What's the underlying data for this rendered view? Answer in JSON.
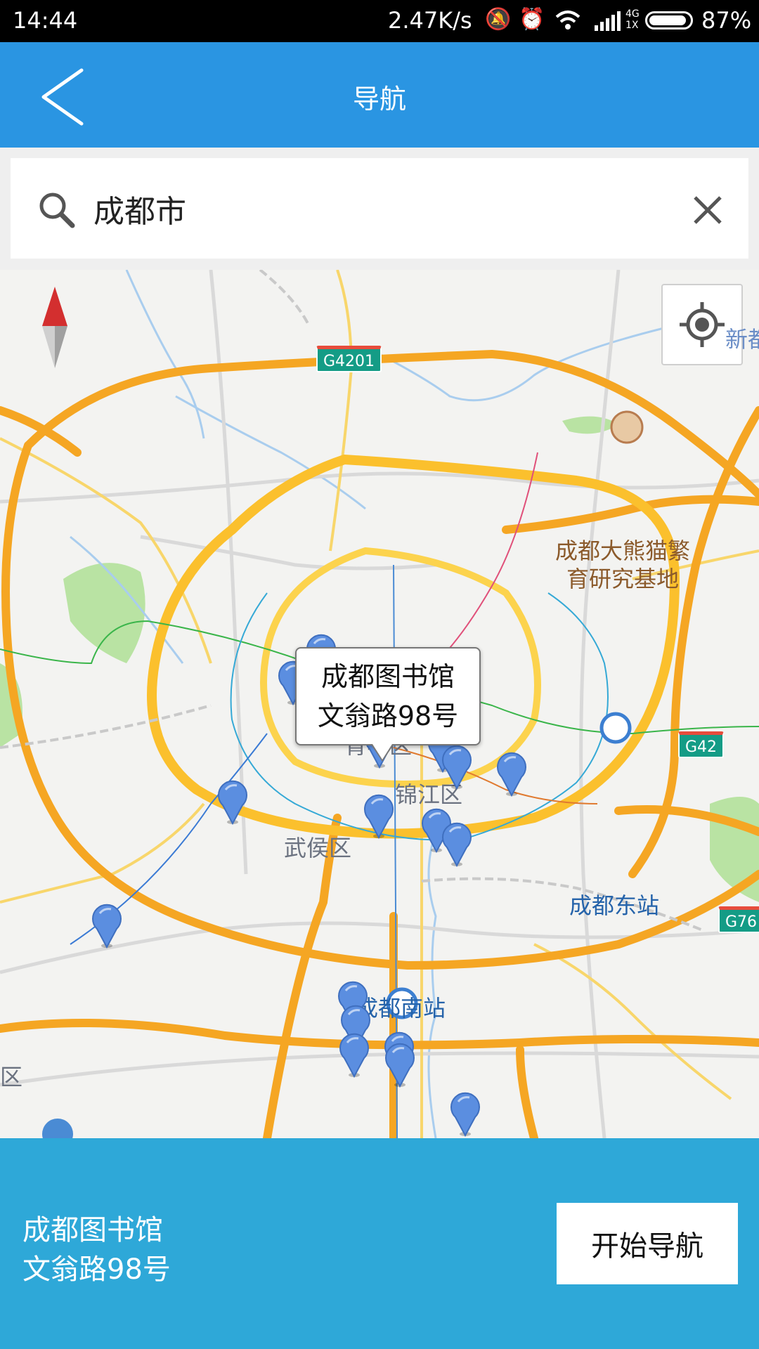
{
  "status_bar": {
    "time": "14:44",
    "network_speed": "2.47K/s",
    "signal_type": "4G",
    "sim_label": "1X",
    "battery_percent": "87%",
    "icons": [
      "mute-icon",
      "alarm-icon",
      "wifi-icon",
      "signal-icon",
      "battery-icon"
    ]
  },
  "app_bar": {
    "title": "导航",
    "back_icon": "chevron-left-icon"
  },
  "search": {
    "value": "成都市",
    "icon": "search-icon",
    "clear_icon": "close-icon"
  },
  "map": {
    "road_shields": {
      "g4201": "G4201",
      "g42": "G42",
      "g76": "G76"
    },
    "labels": {
      "panda_base": "成都大熊猫繁\n育研究基地",
      "jinjiang": "锦江区",
      "wuhou": "武侯区",
      "east_station": "成都东站",
      "south_station": "成都南站",
      "xindu_partial": "新都",
      "qingyang_partial": "青羊区",
      "left_partial": "区"
    },
    "callout": {
      "name": "成都图书馆",
      "address": "文翁路98号"
    },
    "compass_icon": "compass-icon",
    "locate_icon": "locate-icon",
    "colors": {
      "water": "#a9cdee",
      "highway": "#f5a623",
      "green": "#b9e3a3",
      "marker": "#5b8ee0"
    }
  },
  "bottom": {
    "place_name": "成都图书馆",
    "place_address": "文翁路98号",
    "start_button": "开始导航",
    "accent": "#2ea8d8"
  }
}
